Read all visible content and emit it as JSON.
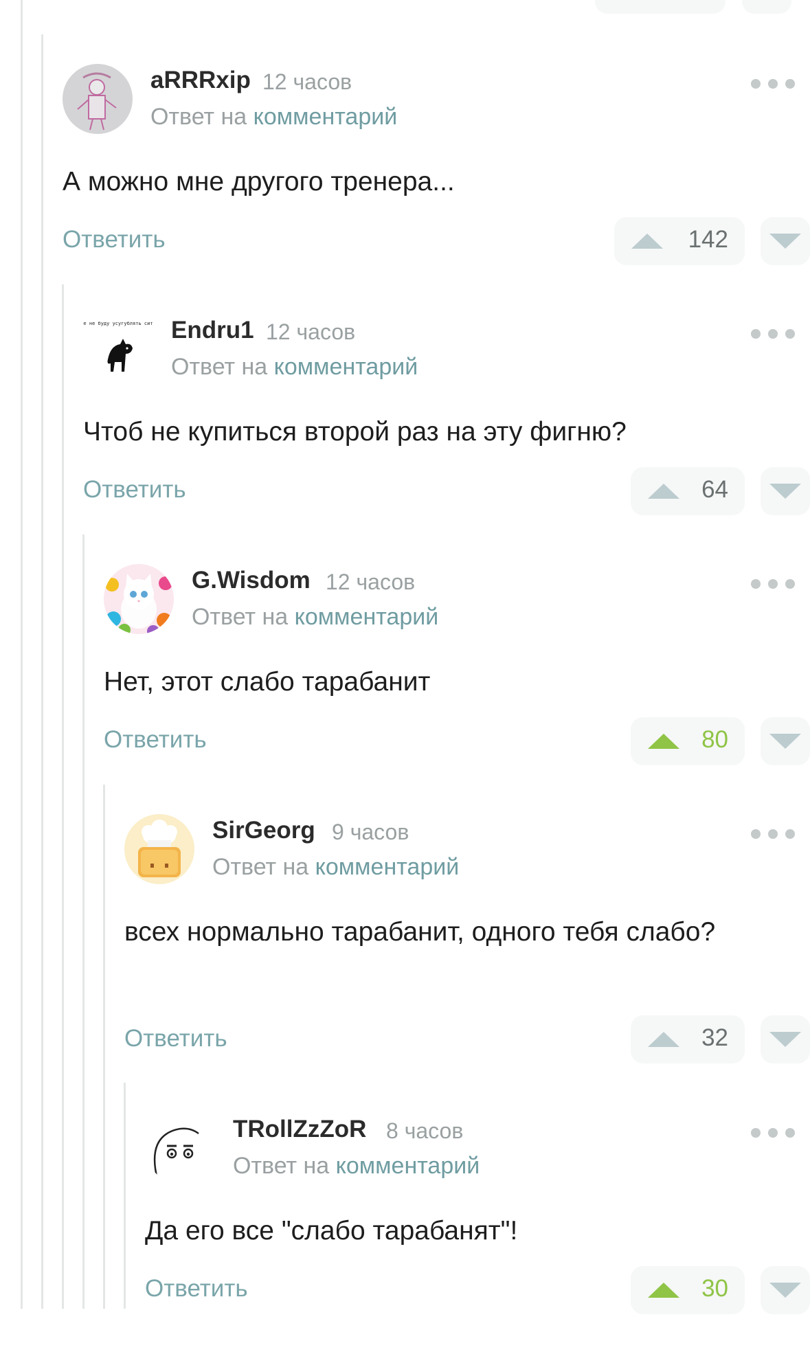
{
  "colors": {
    "accent_link": "#6f9ca1",
    "reply_button": "#7aa5aa",
    "positive_rating": "#8fc446",
    "muted_text": "#9aa0a1",
    "thread_line": "#e4e6e6",
    "vote_bg": "#f6f7f7"
  },
  "comments": [
    {
      "author": "aRRRxip",
      "time": "12 часов",
      "reply_prefix": "Ответ на",
      "reply_link": "комментарий",
      "text": "А можно мне другого тренера...",
      "reply_label": "Ответить",
      "rating": "142",
      "rating_positive": false,
      "avatar_icon": "drawing-avatar-icon"
    },
    {
      "author": "Endru1",
      "time": "12 часов",
      "reply_prefix": "Ответ на",
      "reply_link": "комментарий",
      "text": "Чтоб не купиться второй раз на эту фигню?",
      "reply_label": "Ответить",
      "rating": "64",
      "rating_positive": false,
      "avatar_icon": "black-cat-avatar-icon",
      "avatar_caption": "двайте не буду усугублять ситуацию"
    },
    {
      "author": "G.Wisdom",
      "time": "12 часов",
      "reply_prefix": "Ответ на",
      "reply_link": "комментарий",
      "text": "Нет, этот слабо тарабанит",
      "reply_label": "Ответить",
      "rating": "80",
      "rating_positive": true,
      "avatar_icon": "kitten-avatar-icon"
    },
    {
      "author": "SirGeorg",
      "time": "9 часов",
      "reply_prefix": "Ответ на",
      "reply_link": "комментарий",
      "text": "всех нормально тарабанит, одного тебя слабо?",
      "reply_label": "Ответить",
      "rating": "32",
      "rating_positive": false,
      "avatar_icon": "chef-toaster-avatar-icon"
    },
    {
      "author": "TRollZzZoR",
      "time": "8 часов",
      "reply_prefix": "Ответ на",
      "reply_link": "комментарий",
      "text": "Да его все \"слабо тарабанят\"!",
      "reply_label": "Ответить",
      "rating": "30",
      "rating_positive": true,
      "avatar_icon": "sleepy-face-avatar-icon"
    }
  ]
}
